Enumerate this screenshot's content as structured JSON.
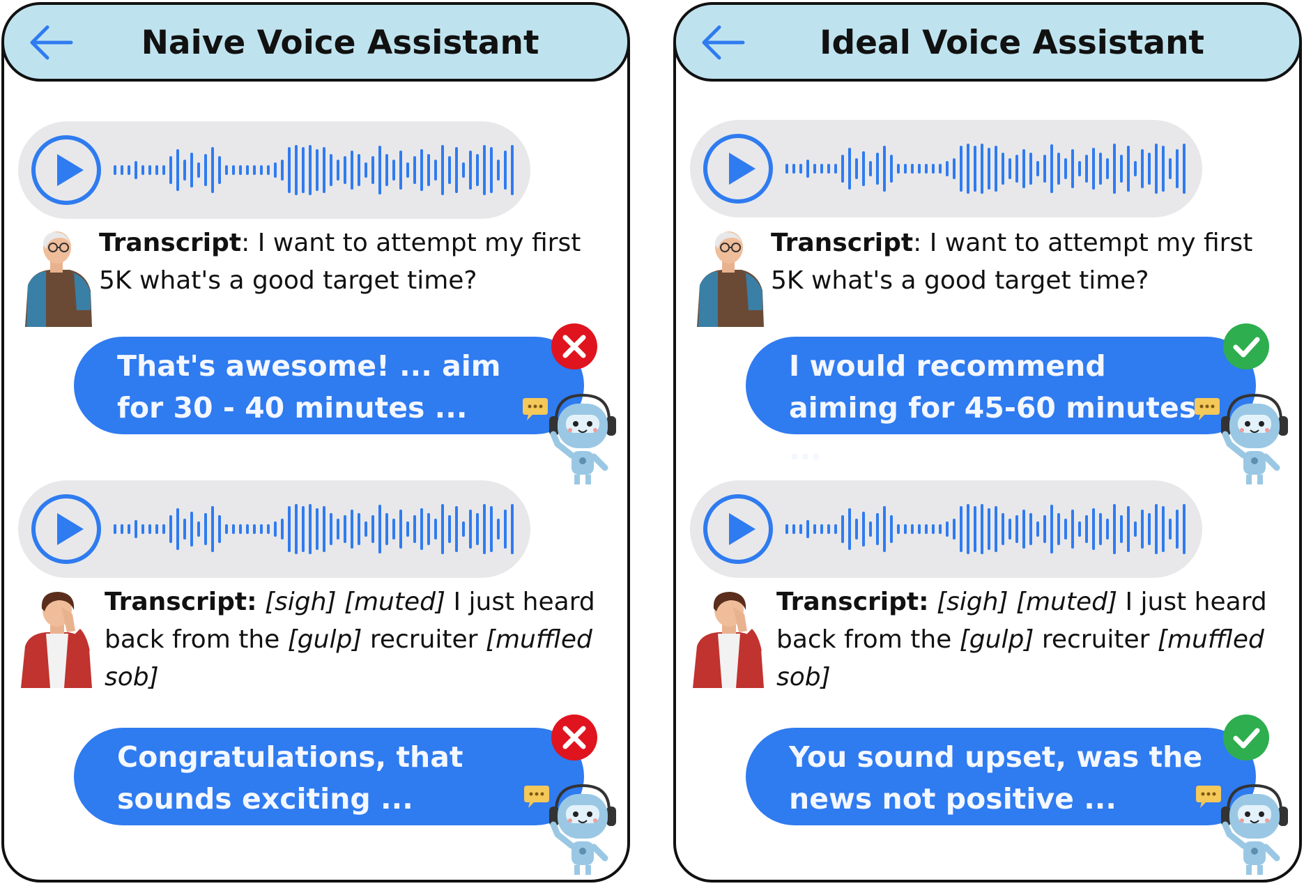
{
  "colors": {
    "header_bg": "#bfe3ee",
    "voice_bubble_bg": "#e8e8ea",
    "waveform": "#2f7bf0",
    "reply_bubble": "#2f7bf0",
    "wrong": "#e0141e",
    "right": "#2eae4e"
  },
  "panels": [
    {
      "title": "Naive Voice Assistant",
      "conversations": [
        {
          "transcript_label": "Transcript",
          "transcript_sep": ": ",
          "transcript_parts": [
            {
              "text": "I want to attempt my first 5K what's a good target time?",
              "italic": false
            }
          ],
          "user_avatar": "elderly-man-avatar",
          "reply": "That's awesome! ... aim for 30 - 40 minutes ...",
          "verdict_icon": "red-x-icon"
        },
        {
          "transcript_label": "Transcript:",
          "transcript_sep": " ",
          "transcript_parts": [
            {
              "text": "[sigh] [muted]",
              "italic": true
            },
            {
              "text": " I just heard back from the ",
              "italic": false
            },
            {
              "text": "[gulp]",
              "italic": true
            },
            {
              "text": " recruiter ",
              "italic": false
            },
            {
              "text": "[muffled sob]",
              "italic": true
            }
          ],
          "user_avatar": "upset-man-avatar",
          "reply": "Congratulations, that sounds exciting ...",
          "verdict_icon": "red-x-icon"
        }
      ]
    },
    {
      "title": "Ideal Voice Assistant",
      "conversations": [
        {
          "transcript_label": "Transcript",
          "transcript_sep": ": ",
          "transcript_parts": [
            {
              "text": "I want to attempt my first 5K what's a good target time?",
              "italic": false
            }
          ],
          "user_avatar": "elderly-man-avatar",
          "reply": "I would recommend aiming for 45-60 minutes ...",
          "verdict_icon": "green-check-icon"
        },
        {
          "transcript_label": "Transcript:",
          "transcript_sep": " ",
          "transcript_parts": [
            {
              "text": "[sigh] [muted]",
              "italic": true
            },
            {
              "text": " I just heard back from the ",
              "italic": false
            },
            {
              "text": "[gulp]",
              "italic": true
            },
            {
              "text": " recruiter ",
              "italic": false
            },
            {
              "text": "[muffled sob]",
              "italic": true
            }
          ],
          "user_avatar": "upset-man-avatar",
          "reply": "You sound upset, was the news not positive ...",
          "verdict_icon": "green-check-icon"
        }
      ]
    }
  ]
}
